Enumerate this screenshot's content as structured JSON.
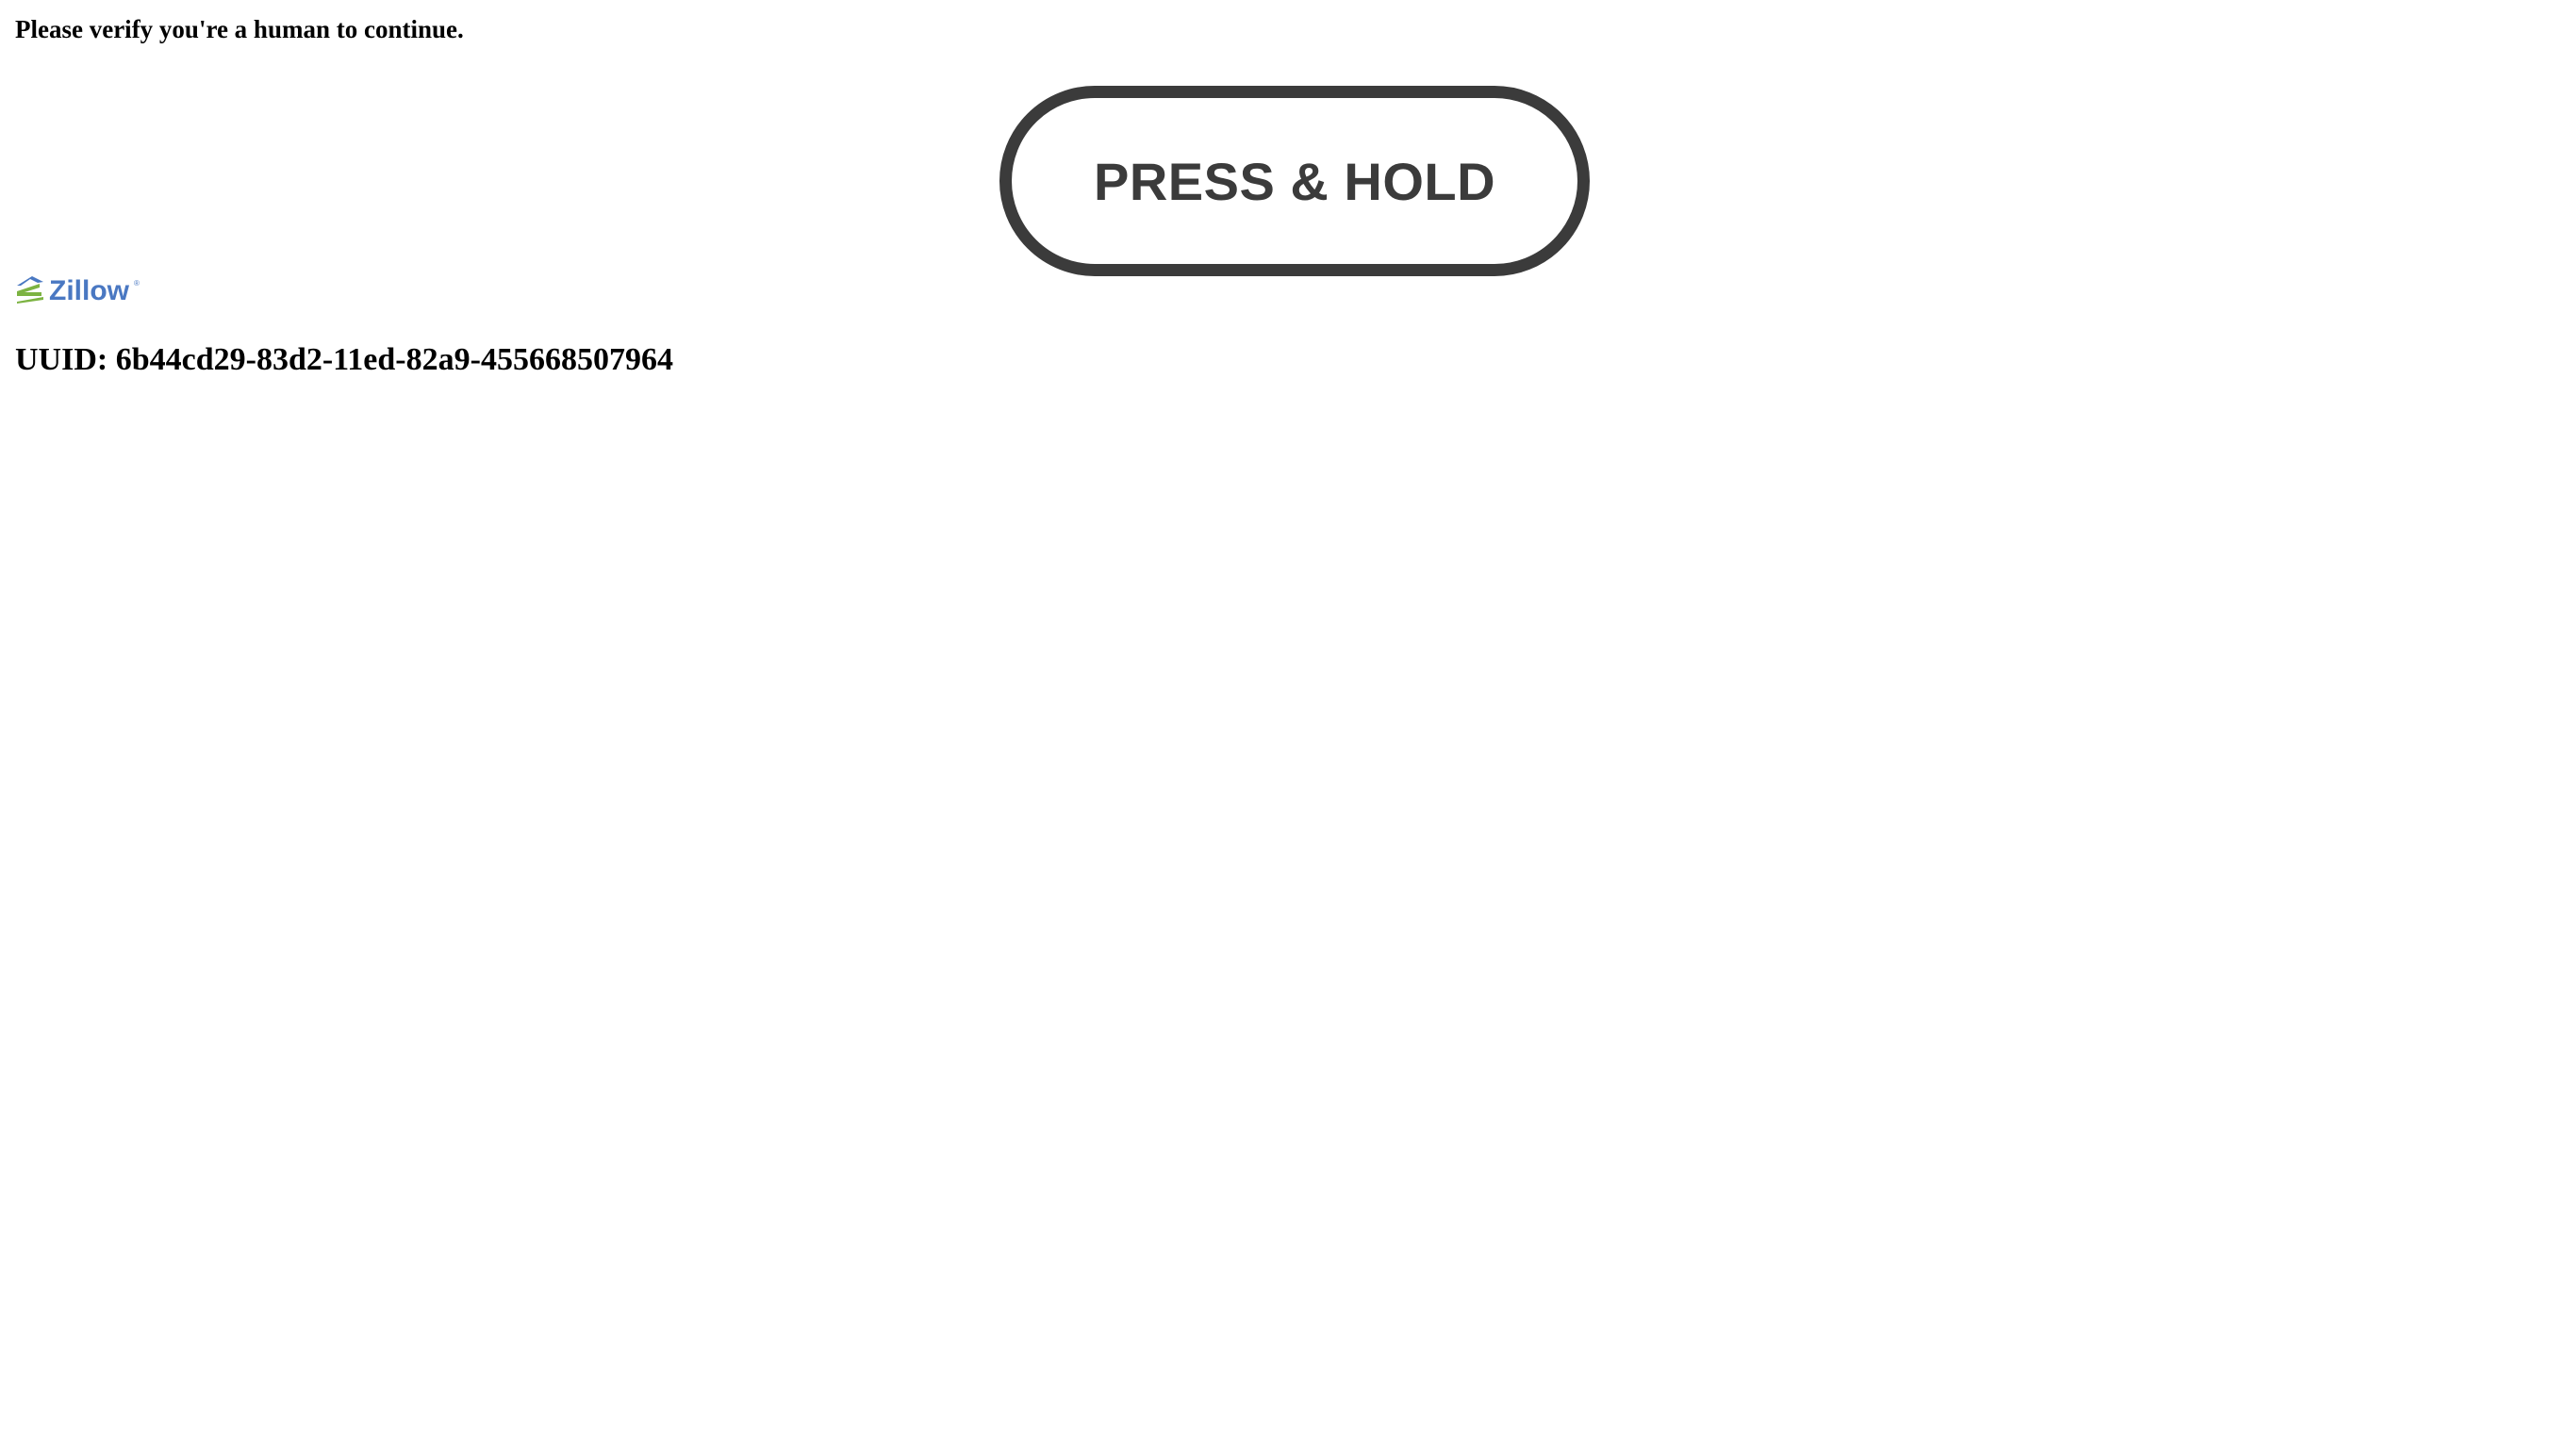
{
  "prompt_text": "Please verify you're a human to continue.",
  "button": {
    "label": "PRESS & HOLD",
    "color": "#3b3b3b"
  },
  "logo": {
    "brand": "Zillow",
    "icon": "zillow-logo-icon",
    "colors": {
      "text": "#4a78c2",
      "mark_top": "#4a78c2",
      "mark_bottom": "#7cb342"
    }
  },
  "uuid_text": "UUID: 6b44cd29-83d2-11ed-82a9-455668507964"
}
